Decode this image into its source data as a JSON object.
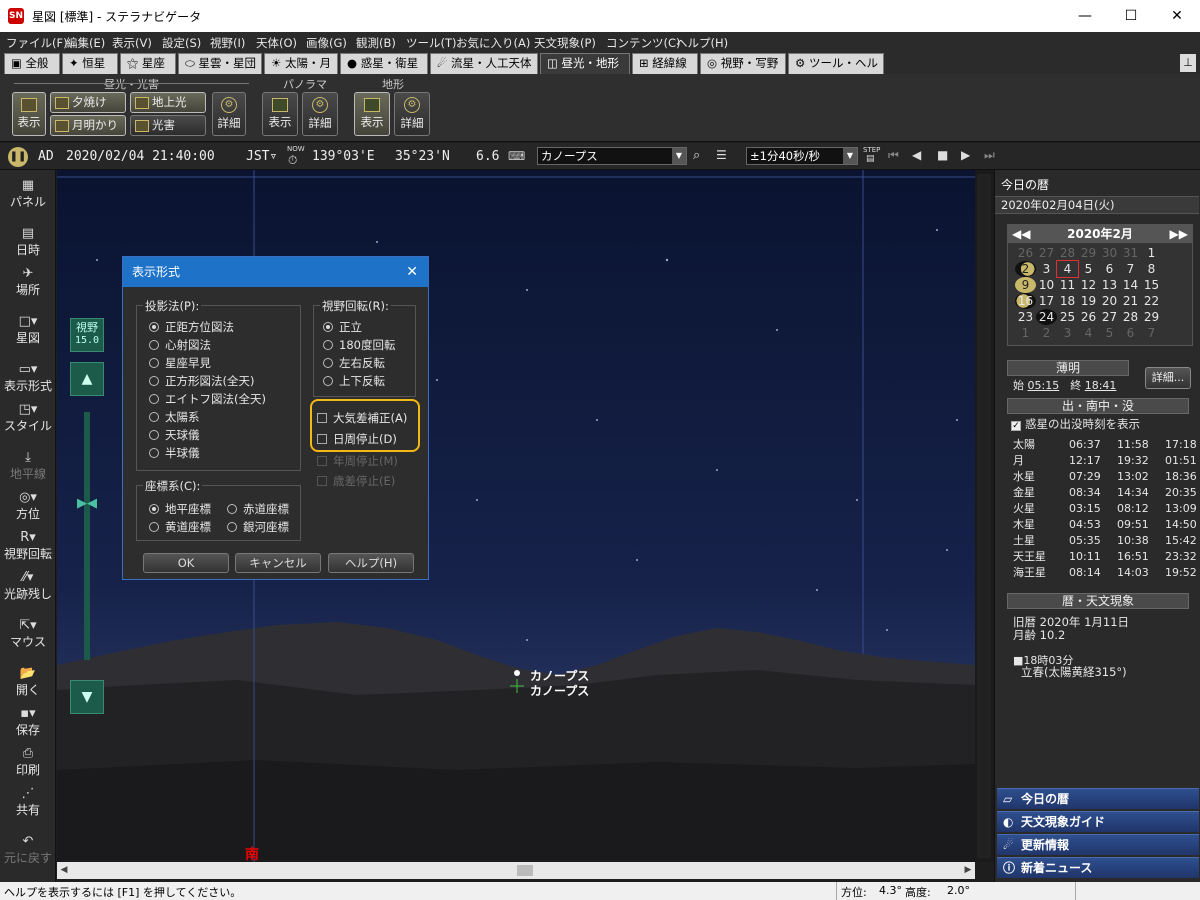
{
  "window": {
    "title": "星図 [標準] - ステラナビゲータ",
    "app_icon": "SN"
  },
  "menu": [
    "ファイル(F)",
    "編集(E)",
    "表示(V)",
    "設定(S)",
    "視野(I)",
    "天体(O)",
    "画像(G)",
    "観測(B)",
    "ツール(T)",
    "お気に入り(A)",
    "天文現象(P)",
    "コンテンツ(C)",
    "ヘルプ(H)"
  ],
  "tabs": [
    "全般",
    "恒星",
    "星座",
    "星雲・星団",
    "太陽・月",
    "惑星・衛星",
    "流星・人工天体",
    "昼光・地形",
    "経緯線",
    "視野・写野",
    "ツール・ヘルプ"
  ],
  "ribbon": {
    "group1": "昼光・光害",
    "group2": "パノラマ",
    "group3": "地形",
    "show": "表示",
    "detail": "詳細",
    "sunset": "夕焼け",
    "moonlight": "月明かり",
    "earthshine": "地上光",
    "lightpollution": "光害"
  },
  "toolbar": {
    "era": "AD",
    "datetime": "2020/02/04 21:40:00",
    "tz": "JST▿",
    "now_label": "NOW",
    "longitude": "139°03'E",
    "latitude": "35°23'N",
    "magnitude": "6.6",
    "target": "カノープス",
    "step": "±1分40秒/秒",
    "step_label": "STEP"
  },
  "sidebar": [
    "パネル",
    "日時",
    "場所",
    "星図",
    "表示形式",
    "スタイル",
    "地平線",
    "方位",
    "視野回転",
    "光跡残し",
    "マウス",
    "開く",
    "保存",
    "印刷",
    "共有",
    "元に戻す"
  ],
  "sky": {
    "fov_label": "視野",
    "fov_value": "15.0",
    "star1": "カノープス",
    "star2": "カノープス",
    "direction": "南"
  },
  "dialog": {
    "title": "表示形式",
    "projection_label": "投影法(P):",
    "projections": [
      "正距方位図法",
      "心射図法",
      "星座早見",
      "正方形図法(全天)",
      "エイトフ図法(全天)",
      "太陽系",
      "天球儀",
      "半球儀"
    ],
    "rotation_label": "視野回転(R):",
    "rotations": [
      "正立",
      "180度回転",
      "左右反転",
      "上下反転"
    ],
    "check1": "大気差補正(A)",
    "check2": "日周停止(D)",
    "check3": "年周停止(M)",
    "check4": "歳差停止(E)",
    "coord_label": "座標系(C):",
    "coords": [
      "地平座標",
      "赤道座標",
      "黄道座標",
      "銀河座標"
    ],
    "ok": "OK",
    "cancel": "キャンセル",
    "help": "ヘルプ(H)"
  },
  "rpanel": {
    "header": "今日の暦",
    "date": "2020年02月04日(火)",
    "month": "2020年2月",
    "calendar": [
      [
        "26",
        "27",
        "28",
        "29",
        "30",
        "31",
        "1"
      ],
      [
        "2",
        "3",
        "4",
        "5",
        "6",
        "7",
        "8"
      ],
      [
        "9",
        "10",
        "11",
        "12",
        "13",
        "14",
        "15"
      ],
      [
        "16",
        "17",
        "18",
        "19",
        "20",
        "21",
        "22"
      ],
      [
        "23",
        "24",
        "25",
        "26",
        "27",
        "28",
        "29"
      ],
      [
        "1",
        "2",
        "3",
        "4",
        "5",
        "6",
        "7"
      ]
    ],
    "twilight_label": "薄明",
    "start_label": "始",
    "start": "05:15",
    "end_label": "終",
    "end": "18:41",
    "detail_btn": "詳細...",
    "rise_label": "出・南中・没",
    "planet_check": "惑星の出没時刻を表示",
    "bodies": [
      [
        "太陽",
        "06:37",
        "11:58",
        "17:18"
      ],
      [
        "月",
        "12:17",
        "19:32",
        "01:51"
      ],
      [
        "水星",
        "07:29",
        "13:02",
        "18:36"
      ],
      [
        "金星",
        "08:34",
        "14:34",
        "20:35"
      ],
      [
        "火星",
        "03:15",
        "08:12",
        "13:09"
      ],
      [
        "木星",
        "04:53",
        "09:51",
        "14:50"
      ],
      [
        "土星",
        "05:35",
        "10:38",
        "15:42"
      ],
      [
        "天王星",
        "10:11",
        "16:51",
        "23:32"
      ],
      [
        "海王星",
        "08:14",
        "14:03",
        "19:52"
      ]
    ],
    "calendar_label": "暦・天文現象",
    "lunar": "旧暦 2020年 1月11日",
    "moonage": "月齢 10.2",
    "event_time": "■18時03分",
    "event": "立春(太陽黄経315°)",
    "nav": [
      "今日の暦",
      "天文現象ガイド",
      "更新情報",
      "新着ニュース"
    ]
  },
  "status": {
    "help": "ヘルプを表示するには [F1] を押してください。",
    "azimuth": "方位:",
    "azimuth_val": "4.3°",
    "alt": "高度:",
    "alt_val": "2.0°"
  }
}
